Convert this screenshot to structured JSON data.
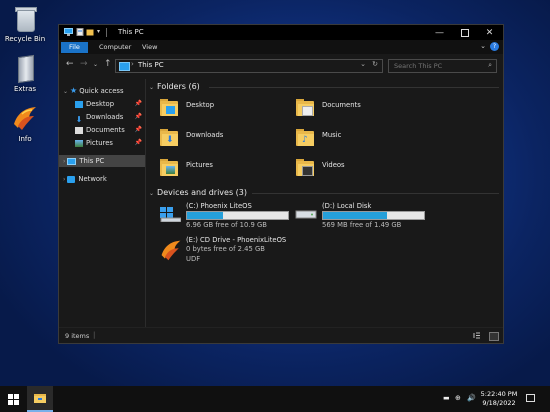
{
  "desktop": {
    "icons": [
      {
        "label": "Recycle Bin",
        "icon": "recycle-bin-icon"
      },
      {
        "label": "Extras",
        "icon": "extras-book-icon"
      },
      {
        "label": "Info",
        "icon": "phoenix-logo-icon"
      }
    ]
  },
  "window": {
    "title": "This PC",
    "ribbon_tabs": [
      "File",
      "Computer",
      "View"
    ],
    "address": {
      "path": "This PC"
    },
    "search": {
      "placeholder": "Search This PC"
    },
    "nav": {
      "quick_access": "Quick access",
      "quick_items": [
        "Desktop",
        "Downloads",
        "Documents",
        "Pictures"
      ],
      "this_pc": "This PC",
      "network": "Network"
    },
    "folders_header": "Folders (6)",
    "folders": [
      "Desktop",
      "Documents",
      "Downloads",
      "Music",
      "Pictures",
      "Videos"
    ],
    "drives_header": "Devices and drives (3)",
    "drives": [
      {
        "name": "(C:) Phoenix LiteOS",
        "free": "6.96 GB free of 10.9 GB",
        "used_fraction": 0.36
      },
      {
        "name": "(D:) Local Disk",
        "free": "569 MB free of 1.49 GB",
        "used_fraction": 0.63
      },
      {
        "name": "(E:) CD Drive - PhoenixLiteOS",
        "free": "0 bytes free of 2.45 GB",
        "fs": "UDF"
      }
    ],
    "status": {
      "item_count": "9 items"
    }
  },
  "taskbar": {
    "time": "5:22:40 PM",
    "date": "9/18/2022"
  },
  "colors": {
    "accent": "#1a73c8",
    "drive_fill": "#26a0da",
    "folder": "#f6cd62"
  }
}
